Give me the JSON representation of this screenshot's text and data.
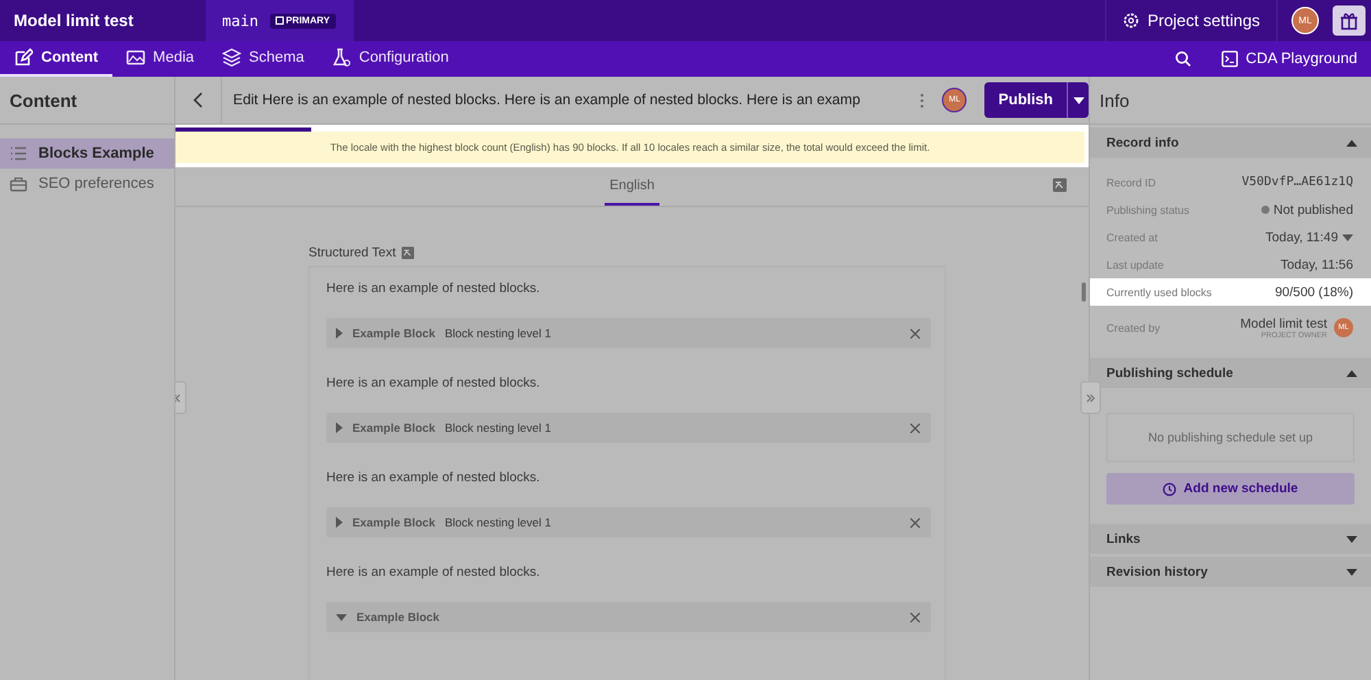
{
  "topbar": {
    "project": "Model limit test",
    "environment": "main",
    "environment_badge": "PRIMARY",
    "settings": "Project settings",
    "avatar": "ML"
  },
  "nav": {
    "tabs": [
      {
        "label": "Content",
        "selected": true,
        "kind": "content"
      },
      {
        "label": "Media",
        "selected": false,
        "kind": "media"
      },
      {
        "label": "Schema",
        "selected": false,
        "kind": "schema"
      },
      {
        "label": "Configuration",
        "selected": false,
        "kind": "config"
      }
    ],
    "playground": "CDA Playground"
  },
  "sidebar": {
    "title": "Content",
    "items": [
      {
        "label": "Blocks Example",
        "selected": true,
        "kind": "list"
      },
      {
        "label": "SEO preferences",
        "selected": false,
        "kind": "case"
      }
    ]
  },
  "editor": {
    "title": "Edit Here is an example of nested blocks. Here is an example of nested blocks. Here is an examp",
    "avatar": "ML",
    "publish": "Publish",
    "banner": {
      "level": 0.15,
      "text": "The locale with the highest block count (English) has 90 blocks. If all 10 locales reach a similar size, the total would exceed the limit."
    },
    "locales": [
      {
        "label": "English",
        "selected": true
      }
    ],
    "field": {
      "label": "Structured Text",
      "content": [
        {
          "kind": "paragraph",
          "text": "Here is an example of nested blocks."
        },
        {
          "kind": "block",
          "label": "Example Block",
          "subtitle": "Block nesting level 1",
          "expanded": false
        },
        {
          "kind": "paragraph",
          "text": "Here is an example of nested blocks."
        },
        {
          "kind": "block",
          "label": "Example Block",
          "subtitle": "Block nesting level 1",
          "expanded": false
        },
        {
          "kind": "paragraph",
          "text": "Here is an example of nested blocks."
        },
        {
          "kind": "block",
          "label": "Example Block",
          "subtitle": "Block nesting level 1",
          "expanded": false
        },
        {
          "kind": "paragraph",
          "text": "Here is an example of nested blocks."
        },
        {
          "kind": "block",
          "label": "Example Block",
          "expanded": true
        }
      ]
    }
  },
  "info": {
    "title": "Info",
    "record_info": {
      "title": "Record info",
      "expanded": true,
      "rows": [
        {
          "label": "Record ID",
          "value": "V50DvfP…AE61z1Q",
          "kind": "mono",
          "highlighted": false
        },
        {
          "label": "Publishing status",
          "value": "Not published",
          "kind": "status",
          "highlighted": false
        },
        {
          "label": "Created at",
          "value": "Today, 11:49",
          "kind": "dropdown",
          "highlighted": false
        },
        {
          "label": "Last update",
          "value": "Today, 11:56",
          "kind": "plain",
          "highlighted": false
        },
        {
          "label": "Currently used blocks",
          "value": "90/500 (18%)",
          "kind": "plain",
          "highlighted": true
        }
      ],
      "created_by": {
        "label": "Created by",
        "name": "Model limit test",
        "role": "PROJECT OWNER",
        "avatar": "ML"
      }
    },
    "schedule": {
      "title": "Publishing schedule",
      "expanded": true,
      "empty": "No publishing schedule set up",
      "button": "Add new schedule"
    },
    "sections": [
      {
        "title": "Links",
        "expanded": false
      },
      {
        "title": "Revision history",
        "expanded": false
      }
    ]
  }
}
